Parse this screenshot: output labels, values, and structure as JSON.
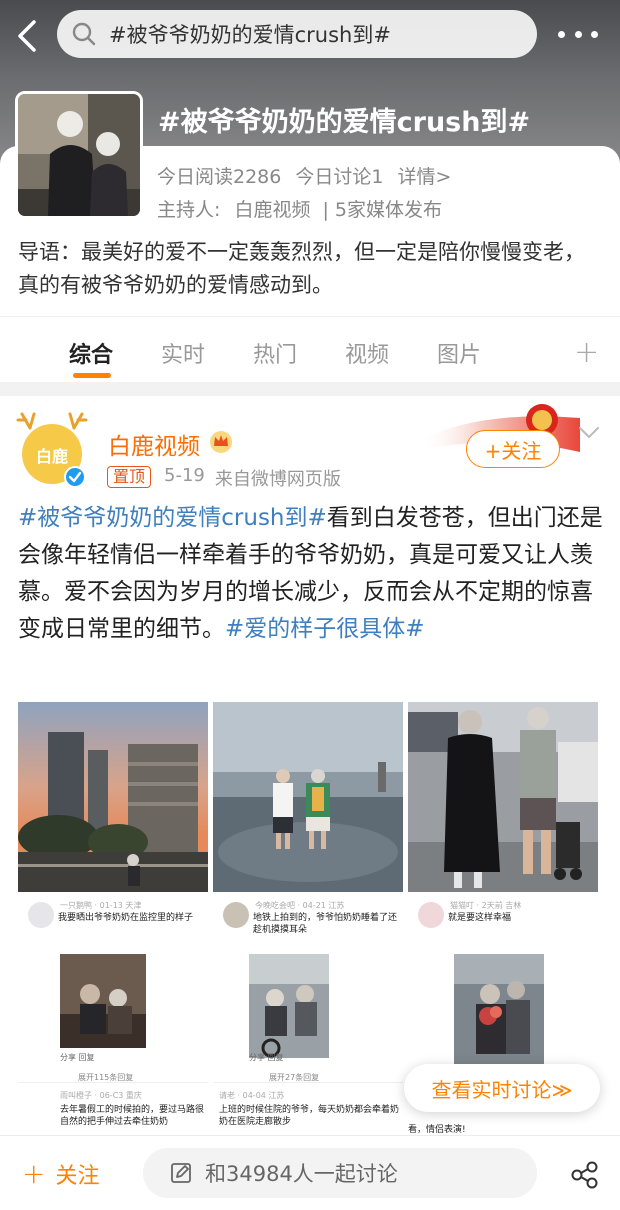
{
  "header": {
    "search_value": "#被爷爷奶奶的爱情crush到#",
    "topic_title": "#被爷爷奶奶的爱情crush到#"
  },
  "topic": {
    "stats": [
      "今日阅读2286",
      "今日讨论1",
      "详情>"
    ],
    "host_label": "主持人:",
    "host_name": "白鹿视频",
    "host_sep": "|",
    "media_count": "5家媒体发布",
    "intro": "导语：最美好的爱不一定轰轰烈烈，但一定是陪你慢慢变老，真的有被爷爷奶奶的爱情感动到。"
  },
  "tabs": [
    {
      "label": "综合",
      "active": true
    },
    {
      "label": "实时",
      "active": false
    },
    {
      "label": "热门",
      "active": false
    },
    {
      "label": "视频",
      "active": false
    },
    {
      "label": "图片",
      "active": false
    }
  ],
  "tab_add": "+",
  "post": {
    "avatar_text": "白鹿",
    "author": "白鹿视频",
    "pinned": "置顶",
    "date": "5-19",
    "source": "来自微博网页版",
    "follow": "+关注",
    "text_tag1": "#被爷爷奶奶的爱情crush到#",
    "text_body": "看到白发苍苍，但出门还是会像年轻情侣一样牵着手的爷爷奶奶，真是可爱又让人羡慕。爱不会因为岁月的增长减少，反而会从不定期的惊喜变成日常里的细节。",
    "text_tag2": "#爱的样子很具体#"
  },
  "screenshots": [
    {
      "meta": "一只鹅鸭 · 01-13 天津",
      "text": "我要晒出爷爷奶奶在监控里的样子",
      "foot": "分享      回复",
      "expand": "展开115条回复",
      "meta2": "雨叫橙子 · 06-C3 重庆",
      "text2": "去年暑假工的时候拍的，要过马路很自然的把手伸过去牵住奶奶"
    },
    {
      "meta": "今晚吃会吧 · 04-21 江苏",
      "text": "地铁上拍到的，爷爷怕奶奶睡着了还趁机摸摸耳朵",
      "foot": "分享      回复",
      "expand": "展开27条回复",
      "meta2": "请老 · 04-04 江苏",
      "text2": "上班的时候住院的爷爷，每天奶奶都会牵着奶奶在医院走廊散步"
    },
    {
      "meta": "猫猫叮 · 2天前 吉林",
      "text": "就是要这样幸福",
      "foot": "",
      "expand": "",
      "meta2": "",
      "text2": "看，情侣表演!"
    }
  ],
  "live_discussion": "查看实时讨论≫",
  "bottom_bar": {
    "follow": "关注",
    "follow_plus": "+",
    "discuss": "和34984人一起讨论"
  },
  "colors": {
    "accent": "#ff8200",
    "tag_blue": "#3f7fbf",
    "author_orange": "#ff6d00"
  }
}
